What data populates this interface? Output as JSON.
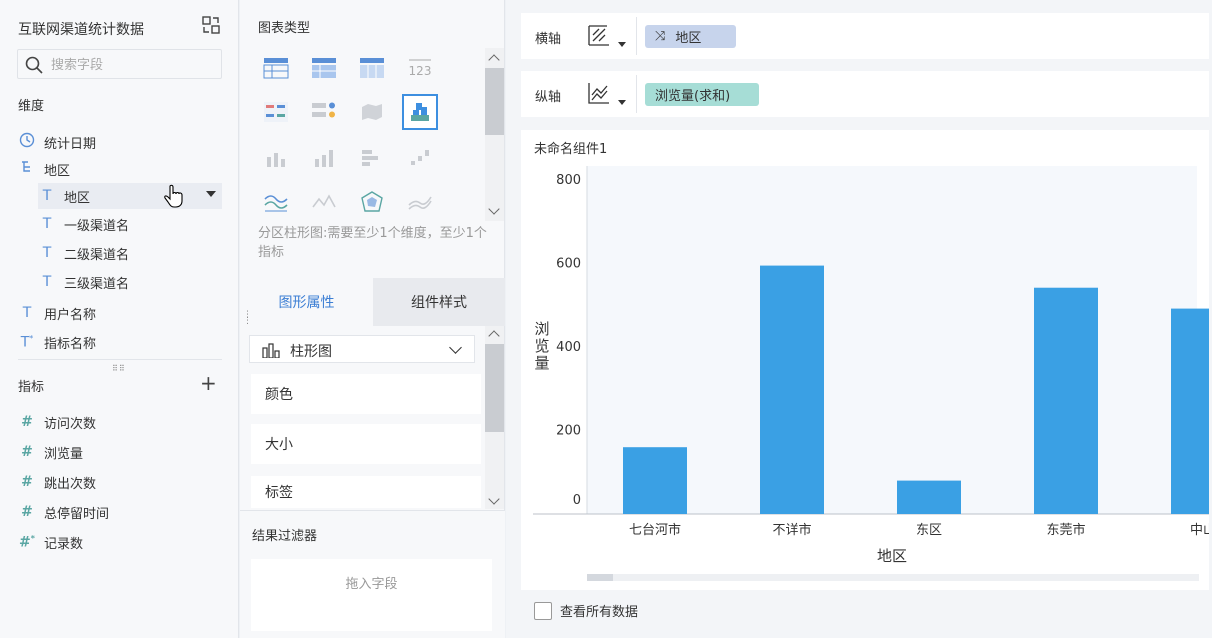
{
  "left_panel": {
    "dataset_title": "互联网渠道统计数据",
    "search_placeholder": "搜索字段",
    "dimension_label": "维度",
    "dimension_fields": [
      {
        "icon": "clock-icon",
        "label": "统计日期"
      },
      {
        "icon": "hierarchy-icon",
        "label": "地区"
      },
      {
        "icon": "text-field-icon",
        "label": "地区"
      },
      {
        "icon": "text-field-icon",
        "label": "一级渠道名"
      },
      {
        "icon": "text-field-icon",
        "label": "二级渠道名"
      },
      {
        "icon": "text-field-icon",
        "label": "三级渠道名"
      },
      {
        "icon": "text-field-icon",
        "label": "用户名称"
      },
      {
        "icon": "text-formula-field-icon",
        "label": "指标名称"
      }
    ],
    "measure_label": "指标",
    "measure_fields": [
      {
        "icon": "number-field-icon",
        "label": "访问次数"
      },
      {
        "icon": "number-field-icon",
        "label": "浏览量"
      },
      {
        "icon": "number-field-icon",
        "label": "跳出次数"
      },
      {
        "icon": "number-field-icon",
        "label": "总停留时间"
      },
      {
        "icon": "number-formula-field-icon",
        "label": "记录数"
      }
    ]
  },
  "middle_panel": {
    "chart_type_title": "图表类型",
    "chart_type_hint": "分区柱形图:需要至少1个维度，至少1个指标",
    "tabs": [
      "图形属性",
      "组件样式"
    ],
    "active_tab": "图形属性",
    "graph_type_select": "柱形图",
    "properties": [
      "颜色",
      "大小",
      "标签"
    ],
    "filter_title": "结果过滤器",
    "filter_drop_hint": "拖入字段"
  },
  "right_panel": {
    "x_axis": {
      "label": "横轴",
      "field": "地区"
    },
    "y_axis": {
      "label": "纵轴",
      "field": "浏览量(求和)"
    },
    "component_title": "未命名组件1",
    "view_all_label": "查看所有数据"
  },
  "colors": {
    "accent": "#3d7fd4",
    "bar": "#3aa0e4",
    "dim_pill": "#c7d4ec",
    "measure_pill": "#a6ddd6"
  },
  "chart_data": {
    "type": "bar",
    "categories": [
      "七台河市",
      "不详市",
      "东区",
      "东莞市",
      "中山"
    ],
    "values": [
      160,
      595,
      80,
      542,
      492
    ],
    "xlabel": "地区",
    "ylabel": "浏览量",
    "ylim": [
      0,
      800
    ],
    "yticks": [
      0,
      200,
      400,
      600,
      800
    ],
    "grid": false
  }
}
